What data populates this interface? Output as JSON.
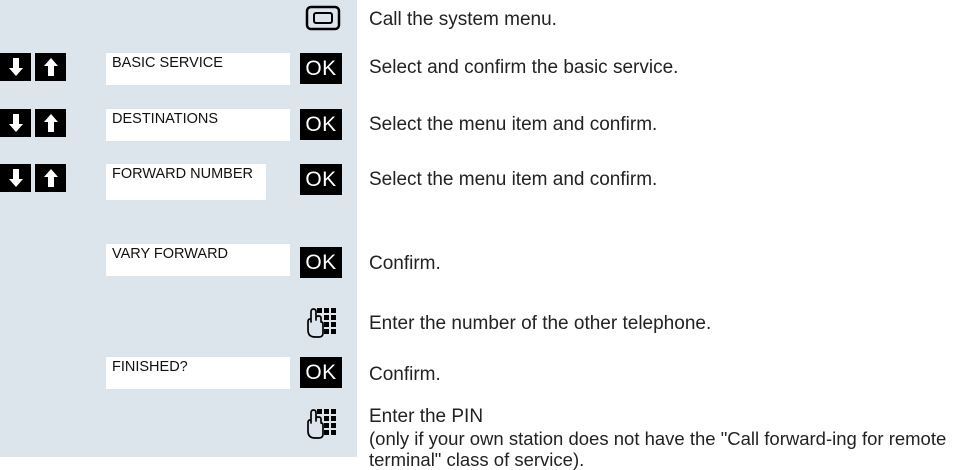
{
  "steps": [
    {
      "action": "Call the system menu."
    },
    {
      "display": "BASIC SERVICE",
      "ok": "OK",
      "action": "Select and confirm the basic service."
    },
    {
      "display": "DESTINATIONS",
      "ok": "OK",
      "action": "Select the menu item and confirm."
    },
    {
      "display": "FORWARD NUMBER",
      "ok": "OK",
      "action": "Select the menu item and confirm."
    },
    {
      "display": "VARY FORWARD",
      "ok": "OK",
      "action": "Confirm."
    },
    {
      "action": "Enter the number of the other telephone."
    },
    {
      "display": "FINISHED?",
      "ok": "OK",
      "action": "Confirm."
    },
    {
      "action": "Enter the PIN",
      "note": "(only if your own station does not have the \"Call forward-ing for remote terminal\" class of service)."
    }
  ],
  "icons": {
    "menu_key": "menu-key-icon",
    "arrow_down": "arrow-down-icon",
    "arrow_up": "arrow-up-icon",
    "keypad": "keypad-icon"
  }
}
